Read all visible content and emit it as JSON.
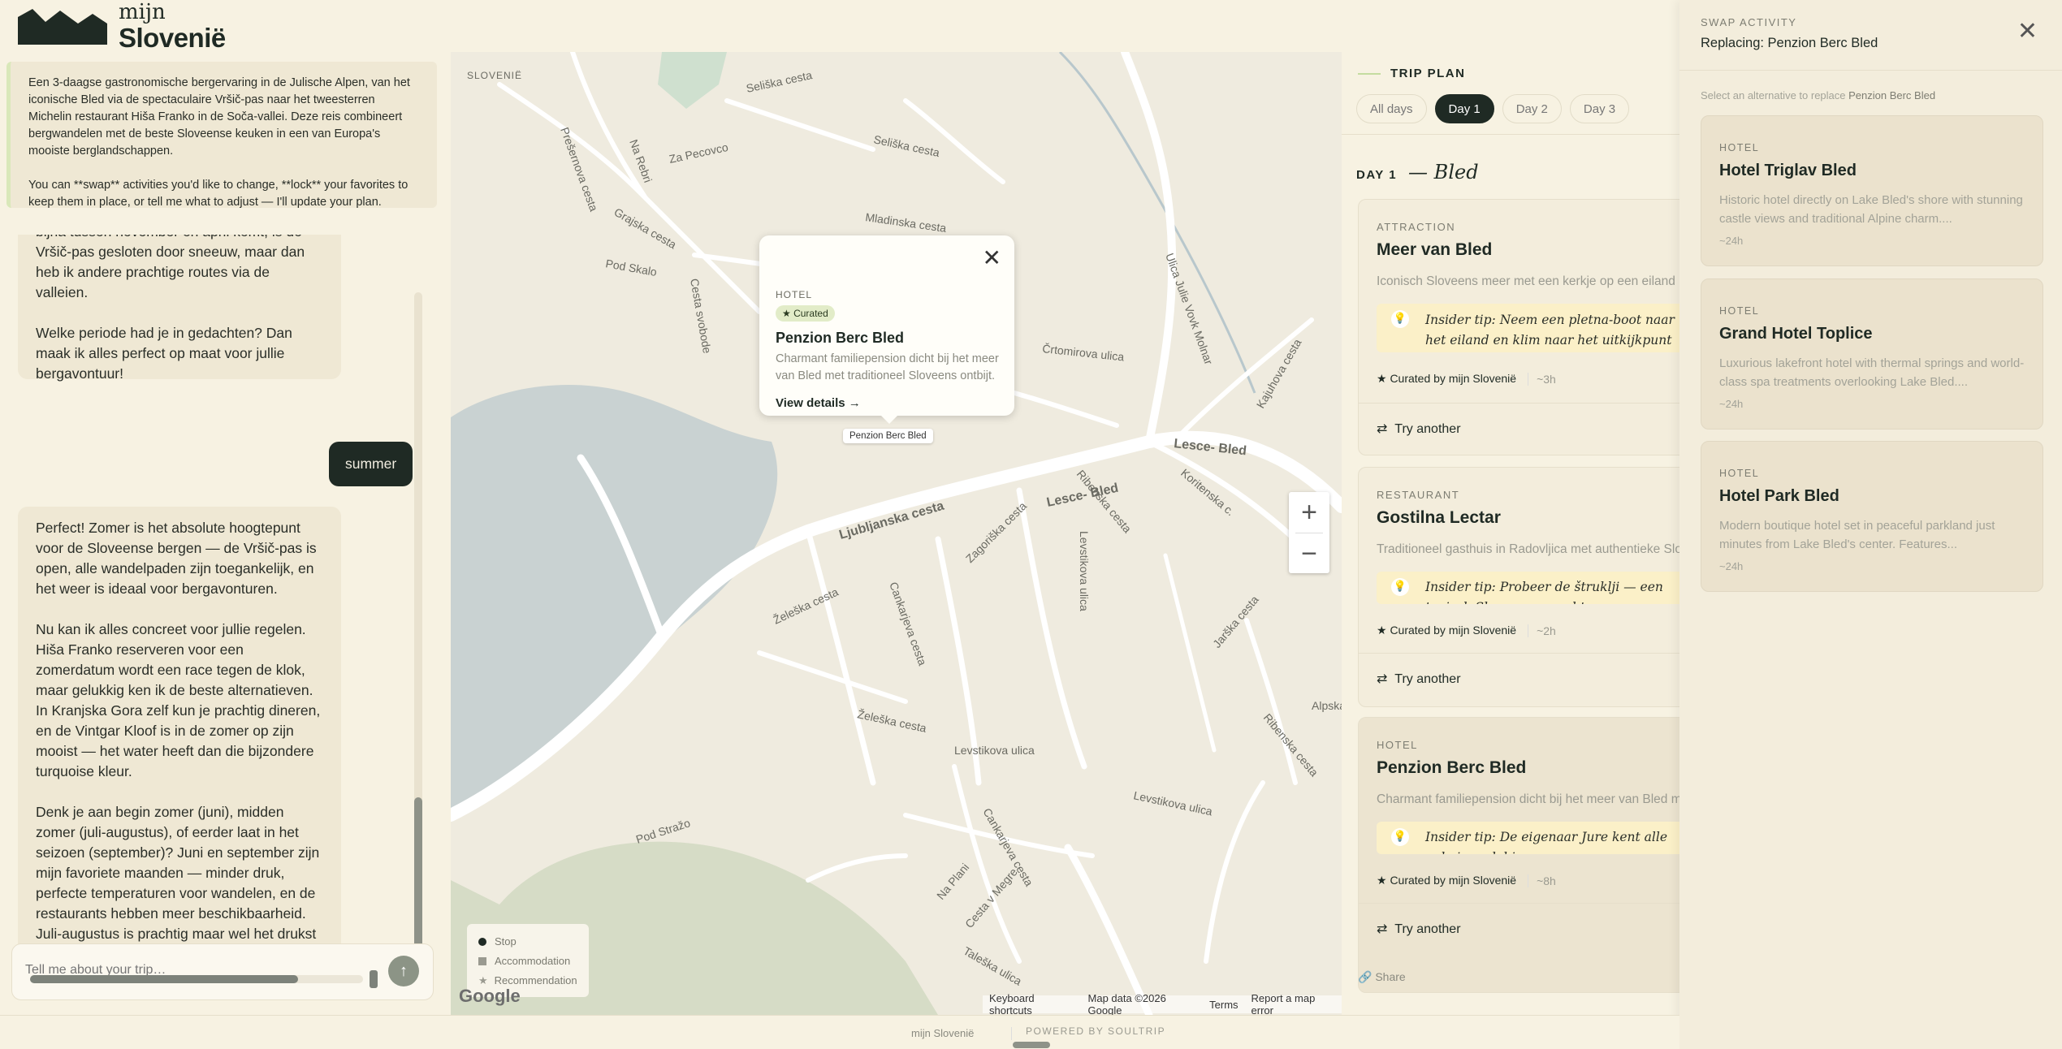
{
  "brand": {
    "line1": "mijn",
    "line2": "Slovenië"
  },
  "chat": {
    "intro_p1": "Een 3-daagse gastronomische bergervaring in de Julische Alpen, van het iconische Bled via de spectaculaire Vršič-pas naar het tweesterren Michelin restaurant Hiša Franko in de Soča-vallei. Deze reis combineert bergwandelen met de beste Sloveense keuken in een van Europa's mooiste berglandschappen.",
    "intro_p2": "You can **swap** activities you'd like to change, **lock** your favorites to keep them in place, or tell me what to adjust — I'll update your plan.",
    "msg1_p1": "bijna tussen november en april komt, is de Vršič-pas gesloten door sneeuw, maar dan heb ik andere prachtige routes via de valleien.",
    "msg1_p2": "Welke periode had je in gedachten? Dan maak ik alles perfect op maat voor jullie bergavontuur!",
    "user_msg": "summer",
    "msg2_p1": "Perfect! Zomer is het absolute hoogtepunt voor de Sloveense bergen — de Vršič-pas is open, alle wandelpaden zijn toegankelijk, en het weer is ideaal voor bergavonturen.",
    "msg2_p2": "Nu kan ik alles concreet voor jullie regelen. Hiša Franko reserveren voor een zomerdatum wordt een race tegen de klok, maar gelukkig ken ik de beste alternatieven. In Kranjska Gora zelf kun je prachtig dineren, en de Vintgar Kloof is in de zomer op zijn mooist — het water heeft dan die bijzondere turquoise kleur.",
    "msg2_p3": "Denk je aan begin zomer (juni), midden zomer (juli-augustus), of eerder laat in het seizoen (september)? Juni en september zijn mijn favoriete maanden — minder druk, perfecte temperaturen voor wandelen, en de restaurants hebben meer beschikbaarheid. Juli-augustus is prachtig maar wel het drukst in de bergen.",
    "input_placeholder": "Tell me about your trip…",
    "send_glyph": "↑"
  },
  "map": {
    "country_label": "SLOVENIË",
    "streets": [
      "Seliška cesta",
      "Prešernova cesta",
      "Na Rebri",
      "Za Pecovco",
      "Mladinska cesta",
      "Grajska cesta",
      "Pod Skalo",
      "Cesta svobode",
      "Črtomirova ulica",
      "Ulica Julie Vovk Molnar",
      "Kajuhova cesta",
      "Lesce- Bled",
      "Koritenska c.",
      "Ribenska cesta",
      "Ljubljanska cesta",
      "Zagoriška cesta",
      "Levstikova ulica",
      "Cankarjeva cesta",
      "Želeška cesta",
      "Jarška cesta",
      "Levstikova ulica",
      "Pod Stražo",
      "Na Plani",
      "Cesta v Megre",
      "Taleška ulica",
      "Alpska c."
    ],
    "popup": {
      "type": "HOTEL",
      "badge": "★ Curated",
      "name": "Penzion Berc Bled",
      "desc": "Charmant familiepension dicht bij het meer van Bled met traditioneel Sloveens ontbijt.",
      "link": "View details →",
      "close": "✕"
    },
    "pin_label": "Penzion Berc Bled",
    "zoom_in": "+",
    "zoom_out": "−",
    "legend": {
      "stop": "Stop",
      "accommodation": "Accommodation",
      "recommendation": "Recommendation",
      "star": "★"
    },
    "google": "Google",
    "attribution": {
      "shortcuts": "Keyboard shortcuts",
      "data": "Map data ©2026 Google",
      "terms": "Terms",
      "report": "Report a map error"
    }
  },
  "trip": {
    "title": "TRIP PLAN",
    "tabs": [
      "All days",
      "Day 1",
      "Day 2",
      "Day 3"
    ],
    "active_tab": 1,
    "day_label": "DAY 1",
    "day_title": "— Bled",
    "cards": [
      {
        "category": "ATTRACTION",
        "name": "Meer van Bled",
        "desc": "Iconisch Sloveens meer met een kerkje op een eiland",
        "tip": "Insider tip: Neem een pletna-boot naar het eiland en klim naar het uitkijkpunt voor het beste uitzicht.",
        "curated": "★ Curated by mijn Slovenië",
        "duration": "~3h",
        "try": "Try another"
      },
      {
        "category": "RESTAURANT",
        "name": "Gostilna Lectar",
        "desc": "Traditioneel gasthuis in Radovljica met authentieke Sloveense keuken",
        "tip": "Insider tip: Probeer de štruklji — een typisch Sloveens gerecht",
        "curated": "★ Curated by mijn Slovenië",
        "duration": "~2h",
        "try": "Try another"
      },
      {
        "category": "HOTEL",
        "name": "Penzion Berc Bled",
        "desc": "Charmant familiepension dicht bij het meer van Bled met traditioneel Sloveens ontbijt",
        "tip": "Insider tip: De eigenaar Jure kent alle geheime plekjes",
        "curated": "★ Curated by mijn Slovenië",
        "duration": "~8h",
        "try": "Try another"
      }
    ],
    "share": "Share",
    "bulb": "💡",
    "swap_glyph": "⇄"
  },
  "swap": {
    "label": "SWAP ACTIVITY",
    "replacing": "Replacing: Penzion Berc Bled",
    "close": "✕",
    "hint_prefix": "Select an alternative to replace ",
    "hint_target": "Penzion Berc Bled",
    "alternatives": [
      {
        "type": "HOTEL",
        "name": "Hotel Triglav Bled",
        "desc": "Historic hotel directly on Lake Bled's shore with stunning castle views and traditional Alpine charm....",
        "duration": "~24h"
      },
      {
        "type": "HOTEL",
        "name": "Grand Hotel Toplice",
        "desc": "Luxurious lakefront hotel with thermal springs and world-class spa treatments overlooking Lake Bled....",
        "duration": "~24h"
      },
      {
        "type": "HOTEL",
        "name": "Hotel Park Bled",
        "desc": "Modern boutique hotel set in peaceful parkland just minutes from Lake Bled's center. Features...",
        "duration": "~24h"
      }
    ]
  },
  "footer": {
    "brand": "mijn Slovenië",
    "powered": "POWERED BY SOULTRIP"
  },
  "colors": {
    "accent": "#1f2a24",
    "background": "#f7f2e2",
    "tip": "#fbf0c8",
    "lake": "#c9d2d2",
    "park": "#d8dfc8"
  }
}
